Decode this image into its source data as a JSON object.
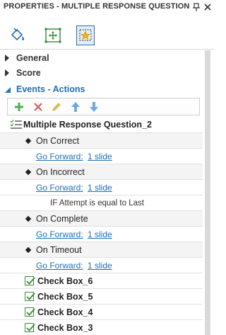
{
  "panel": {
    "title": "PROPERTIES - MULTIPLE RESPONSE QUESTION",
    "title_buttons": [
      "pin-icon",
      "close-icon"
    ]
  },
  "toolstrip": {
    "tools": [
      {
        "name": "fill-icon",
        "selected": false
      },
      {
        "name": "transform-icon",
        "selected": false
      },
      {
        "name": "actions-icon",
        "selected": true
      }
    ]
  },
  "sections": {
    "general": "General",
    "score": "Score",
    "events": "Events - Actions"
  },
  "action_toolbar": {
    "buttons": [
      "add-icon",
      "delete-icon",
      "edit-icon",
      "move-up-icon",
      "move-down-icon"
    ]
  },
  "tree": {
    "root": "Multiple Response Question_2",
    "events": [
      {
        "label": "On Correct",
        "action": "Go Forward:",
        "target": "1 slide",
        "condition": ""
      },
      {
        "label": "On Incorrect",
        "action": "Go Forward:",
        "target": "1 slide",
        "condition": "IF Attempt is equal to Last"
      },
      {
        "label": "On Complete",
        "action": "Go Forward:",
        "target": "1 slide",
        "condition": ""
      },
      {
        "label": "On Timeout",
        "action": "Go Forward:",
        "target": "1 slide",
        "condition": ""
      }
    ],
    "checkboxes": [
      "Check Box_6",
      "Check Box_5",
      "Check Box_4",
      "Check Box_3"
    ]
  },
  "colors": {
    "accent": "#1f6fb5",
    "link": "#1d6fb8",
    "checkbox": "#3a8a3a",
    "add": "#4caf50",
    "delete": "#e05555",
    "edit": "#e8c35a",
    "arrows": "#6fa8dc"
  }
}
